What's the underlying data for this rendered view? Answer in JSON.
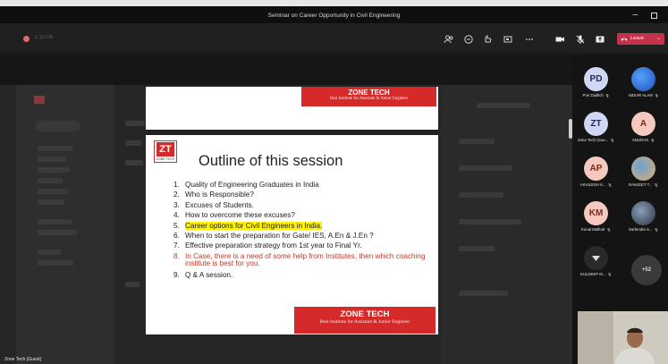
{
  "window": {
    "title": "Seminar on Career Opportunity in Civil Engineering"
  },
  "toolbar": {
    "timer": "1:10:06",
    "icons": [
      "people-icon",
      "chat-icon",
      "reactions-icon",
      "rooms-icon",
      "more-icon",
      "camera-icon",
      "mic-icon",
      "share-icon"
    ],
    "leave_label": "Leave",
    "leave_color": "#c4314b"
  },
  "slide": {
    "header_brand": "ZONE TECH",
    "header_tagline": "Best Institute for Assistant & Junior Engineer",
    "logo_mark": "ZT",
    "logo_name": "ZONE TECH",
    "title": "Outline of this session",
    "items": [
      {
        "num": "1.",
        "text": "Quality of Engineering Graduates in India"
      },
      {
        "num": "2.",
        "text": "Who is Responsible?"
      },
      {
        "num": "3.",
        "text": "Excuses of Students."
      },
      {
        "num": "4.",
        "text": "How to overcome these excuses?"
      },
      {
        "num": "5.",
        "text": "Career options for Civil Engineers in India."
      },
      {
        "num": "6.",
        "text": "When to start the preparation for Gate/ IES, A.En & J.En ?"
      },
      {
        "num": "7.",
        "text": "Effective preparation strategy from 1st year to Final Yr."
      },
      {
        "num": "8.",
        "text": "In Case, there is a need of some help from Institutes, then which coaching institute is best for you."
      },
      {
        "num": "9.",
        "text": "Q & A session."
      }
    ],
    "footer_brand": "ZONE TECH",
    "footer_tagline": "Best Institute for Assistant & Junior Engineer",
    "highlight_color": "#fff200",
    "brand_color": "#d62a2a"
  },
  "presenter_label": "Zone Tech (Guest)",
  "participants": [
    {
      "initials": "PD",
      "name": "Pon Dadlich",
      "bg": "#cfd8f2",
      "fg": "#1e2a54"
    },
    {
      "initials": "",
      "name": "ABSAR ALAM",
      "photo": true
    },
    {
      "initials": "ZT",
      "name": "Zone Tech (Gue...",
      "bg": "#cfd8f2",
      "fg": "#1e2a54"
    },
    {
      "initials": "A",
      "name": "ANURAG",
      "bg": "#f5c9c0",
      "fg": "#7a2a1a"
    },
    {
      "initials": "AP",
      "name": "AKHILESH K...",
      "bg": "#f5c9c0",
      "fg": "#7a2a1a"
    },
    {
      "initials": "",
      "name": "RANJEET T...",
      "photo": true
    },
    {
      "initials": "KM",
      "name": "Kunal Malhotr",
      "bg": "#f5c9c0",
      "fg": "#7a2a1a"
    },
    {
      "initials": "",
      "name": "Sarfendra S...",
      "photo": true
    },
    {
      "initials": "",
      "name": "KULDEEP M...",
      "dark": true
    }
  ],
  "more_count": "+52"
}
